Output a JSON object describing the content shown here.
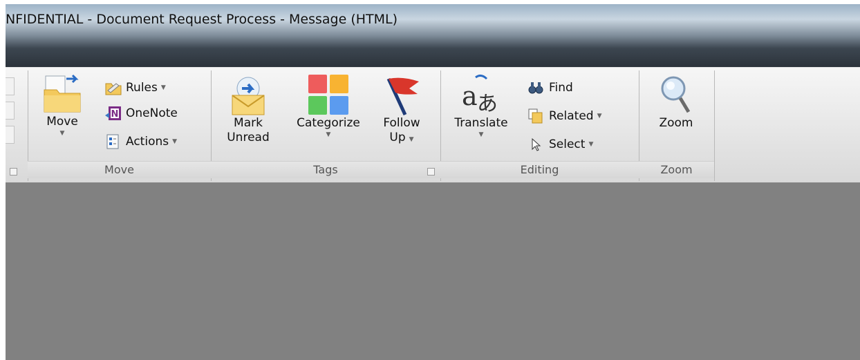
{
  "window": {
    "title": "NFIDENTIAL - Document Request Process  -  Message (HTML)"
  },
  "ribbon": {
    "move": {
      "label": "Move",
      "move_button": "Move",
      "rules": "Rules",
      "onenote": "OneNote",
      "actions": "Actions"
    },
    "tags": {
      "label": "Tags",
      "mark_unread_line1": "Mark",
      "mark_unread_line2": "Unread",
      "categorize": "Categorize",
      "follow_up_line1": "Follow",
      "follow_up_line2": "Up"
    },
    "editing": {
      "label": "Editing",
      "translate": "Translate",
      "find": "Find",
      "related": "Related",
      "select": "Select"
    },
    "zoom": {
      "label": "Zoom",
      "zoom_button": "Zoom"
    }
  },
  "icons": [
    "move-folder-icon",
    "rules-icon",
    "onenote-icon",
    "actions-icon",
    "mark-unread-icon",
    "categorize-icon",
    "follow-up-flag-icon",
    "translate-icon",
    "find-icon",
    "related-icon",
    "select-cursor-icon",
    "zoom-magnifier-icon",
    "dialog-launcher-icon"
  ],
  "colors": {
    "ribbon_bg": "#e6e6e6",
    "content_bg": "#808080",
    "flag_red": "#d9362b"
  }
}
